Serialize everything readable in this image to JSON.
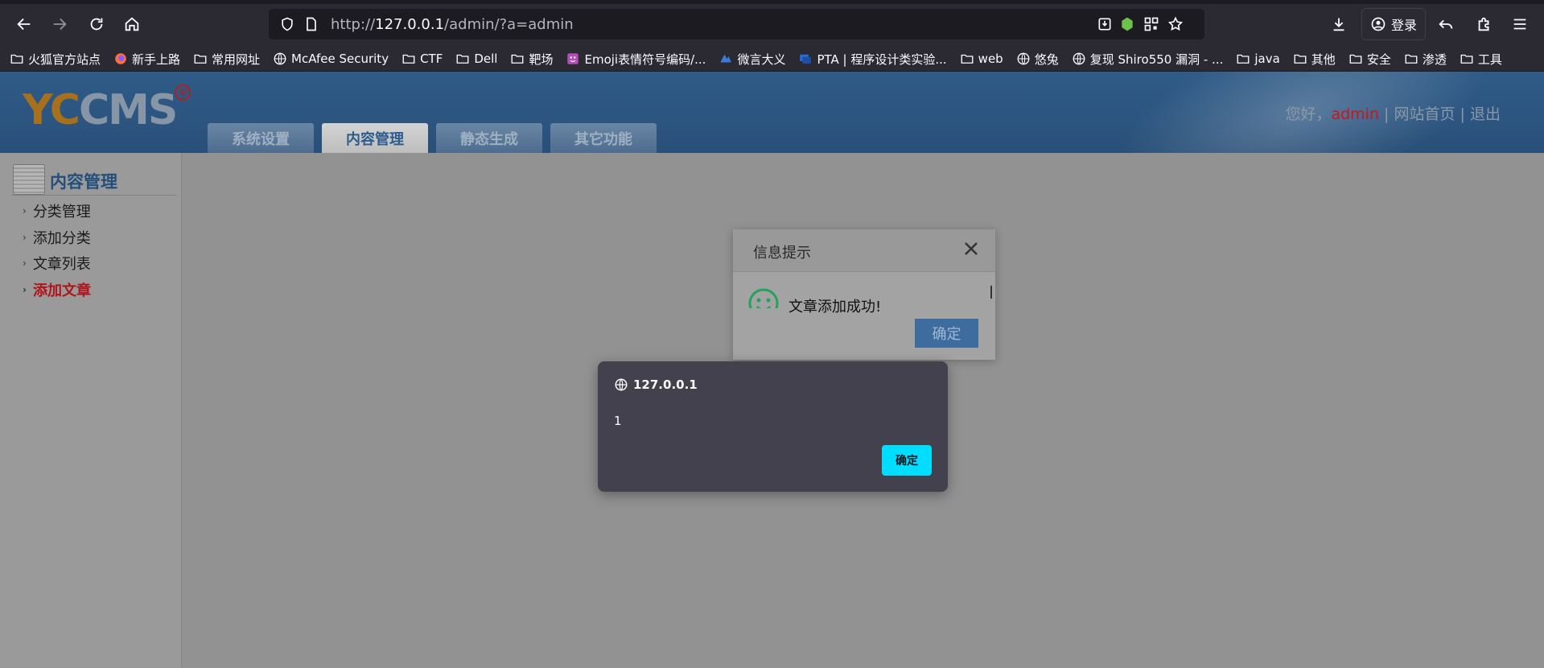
{
  "browser": {
    "url_prefix": "http://",
    "url_host": "127.0.0.1",
    "url_path": "/admin/?a=admin",
    "login_label": "登录"
  },
  "bookmarks": [
    {
      "label": "火狐官方站点",
      "icon": "folder-icon"
    },
    {
      "label": "新手上路",
      "icon": "firefox-icon"
    },
    {
      "label": "常用网址",
      "icon": "folder-icon"
    },
    {
      "label": "McAfee Security",
      "icon": "globe-icon"
    },
    {
      "label": "CTF",
      "icon": "folder-icon"
    },
    {
      "label": "Dell",
      "icon": "folder-icon"
    },
    {
      "label": "靶场",
      "icon": "folder-icon"
    },
    {
      "label": "Emoji表情符号编码/...",
      "icon": "emoji-icon"
    },
    {
      "label": "微言大义",
      "icon": "brand-icon"
    },
    {
      "label": "PTA | 程序设计类实验...",
      "icon": "pta-icon"
    },
    {
      "label": "web",
      "icon": "folder-icon"
    },
    {
      "label": "悠兔",
      "icon": "globe-icon"
    },
    {
      "label": "复现 Shiro550 漏洞 - ...",
      "icon": "globe-icon"
    },
    {
      "label": "java",
      "icon": "folder-icon"
    },
    {
      "label": "其他",
      "icon": "folder-icon"
    },
    {
      "label": "安全",
      "icon": "folder-icon"
    },
    {
      "label": "渗透",
      "icon": "folder-icon"
    },
    {
      "label": "工具",
      "icon": "folder-icon"
    }
  ],
  "header": {
    "logo_yc": "YC",
    "logo_cms": "CMS",
    "logo_mark": "©",
    "greeting_prefix": "您好，",
    "user": "admin",
    "sep1": " | ",
    "site_home": "网站首页",
    "sep2": " | ",
    "logout": "退出",
    "tabs": [
      {
        "label": "系统设置",
        "active": false
      },
      {
        "label": "内容管理",
        "active": true
      },
      {
        "label": "静态生成",
        "active": false
      },
      {
        "label": "其它功能",
        "active": false
      }
    ]
  },
  "sidebar": {
    "title": "内容管理",
    "items": [
      {
        "label": "分类管理",
        "active": false
      },
      {
        "label": "添加分类",
        "active": false
      },
      {
        "label": "文章列表",
        "active": false
      },
      {
        "label": "添加文章",
        "active": true
      }
    ]
  },
  "info_dialog": {
    "title": "信息提示",
    "message": "文章添加成功!",
    "ok_label": "确定"
  },
  "alert": {
    "origin": "127.0.0.1",
    "message": "1",
    "ok_label": "确定"
  },
  "colors": {
    "alert_button": "#00ddff",
    "header_blue": "#2c5580",
    "active_link": "#c8161d"
  }
}
